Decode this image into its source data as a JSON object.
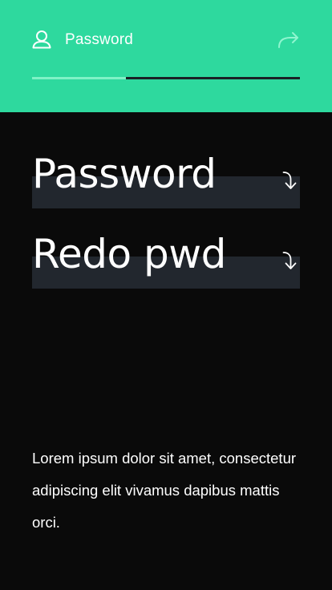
{
  "header": {
    "title": "Password",
    "user_icon": "user-icon",
    "share_icon": "share-forward-icon",
    "progress_fraction": 0.35,
    "colors": {
      "background": "#2ed99e",
      "progress_done": "#7ff2c6",
      "progress_remaining": "#1a2226"
    }
  },
  "fields": [
    {
      "label": "Password",
      "icon": "arrow-down-return-icon"
    },
    {
      "label": "Redo pwd",
      "icon": "arrow-down-return-icon"
    }
  ],
  "body": {
    "text": "Lorem ipsum dolor sit amet, consectetur adipiscing elit vivamus dapibus mattis orci."
  },
  "colors": {
    "page_background": "#0a0a0a",
    "field_background": "#22272e",
    "text": "#ffffff"
  }
}
